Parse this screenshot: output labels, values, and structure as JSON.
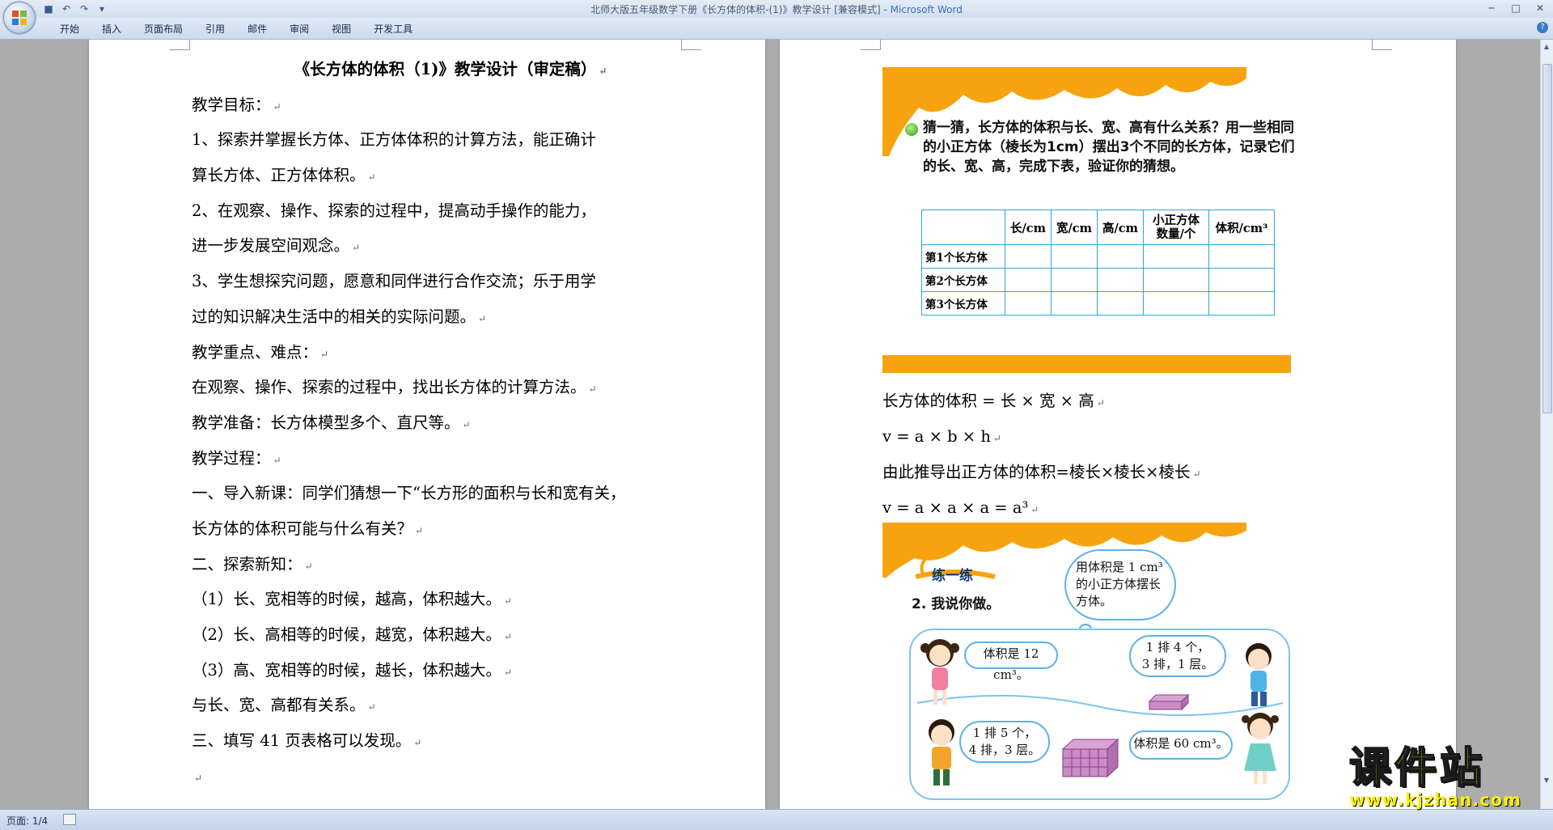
{
  "window": {
    "title": "北师大版五年级数学下册《长方体的体积-(1)》教学设计 [兼容模式] - ",
    "app_name": "Microsoft Word"
  },
  "ribbon_tabs": [
    "开始",
    "插入",
    "页面布局",
    "引用",
    "邮件",
    "审阅",
    "视图",
    "开发工具"
  ],
  "left_page": {
    "title": "《长方体的体积（1)》教学设计（审定稿）",
    "lines": [
      "教学目标：",
      "1、探索并掌握长方体、正方体体积的计算方法，能正确计",
      "算长方体、正方体体积。",
      "2、在观察、操作、探索的过程中，提高动手操作的能力，",
      "进一步发展空间观念。",
      "3、学生想探究问题，愿意和同伴进行合作交流；乐于用学",
      "过的知识解决生活中的相关的实际问题。",
      "教学重点、难点：",
      "在观察、操作、探索的过程中，找出长方体的计算方法。",
      "教学准备：长方体模型多个、直尺等。",
      "教学过程：",
      "一、导入新课：同学们猜想一下“长方形的面积与长和宽有关，",
      "长方体的体积可能与什么有关？",
      "二、探索新知：",
      "（1）长、宽相等的时候，越高，体积越大。",
      "（2）长、高相等的时候，越宽，体积越大。",
      "（3）高、宽相等的时候，越长，体积越大。",
      "与长、宽、高都有关系。",
      "三、填写 41 页表格可以发现。"
    ],
    "paragraph_mark": "↵"
  },
  "right_page": {
    "question": "猜一猜，长方体的体积与长、宽、高有什么关系？用一些相同的小正方体（棱长为1cm）摆出3个不同的长方体，记录它们的长、宽、高，完成下表，验证你的猜想。",
    "table": {
      "headers": [
        "",
        "长/cm",
        "宽/cm",
        "高/cm",
        "小正方体\n数量/个",
        "体积/cm³"
      ],
      "rows": [
        "第1个长方体",
        "第2个长方体",
        "第3个长方体"
      ]
    },
    "formulas": [
      "长方体的体积  =  长  ×  宽  ×  高",
      "v =   a × b × h",
      "由此推导出正方体的体积=棱长×棱长×棱长",
      "v = a × a × a = a³"
    ],
    "exercise_title": "练一练",
    "exercise_question": "2. 我说你做。",
    "thought_bubble": "用体积是 1 cm³ 的小正方体摆长方体。",
    "bubbles": [
      "体积是 12 cm³。",
      "1 排 4 个，\n3 排，1 层。",
      "1 排 5 个，\n4 排，3 层。",
      "体积是 60 cm³。"
    ]
  },
  "status": {
    "page": "页面: 1/4"
  },
  "watermark": {
    "text": "课件站",
    "url": "www.kjzhan.com"
  },
  "colors": {
    "accent_orange": "#f7a30f",
    "table_border": "#2aa8e0",
    "watermark_yellow": "#ffe800"
  }
}
